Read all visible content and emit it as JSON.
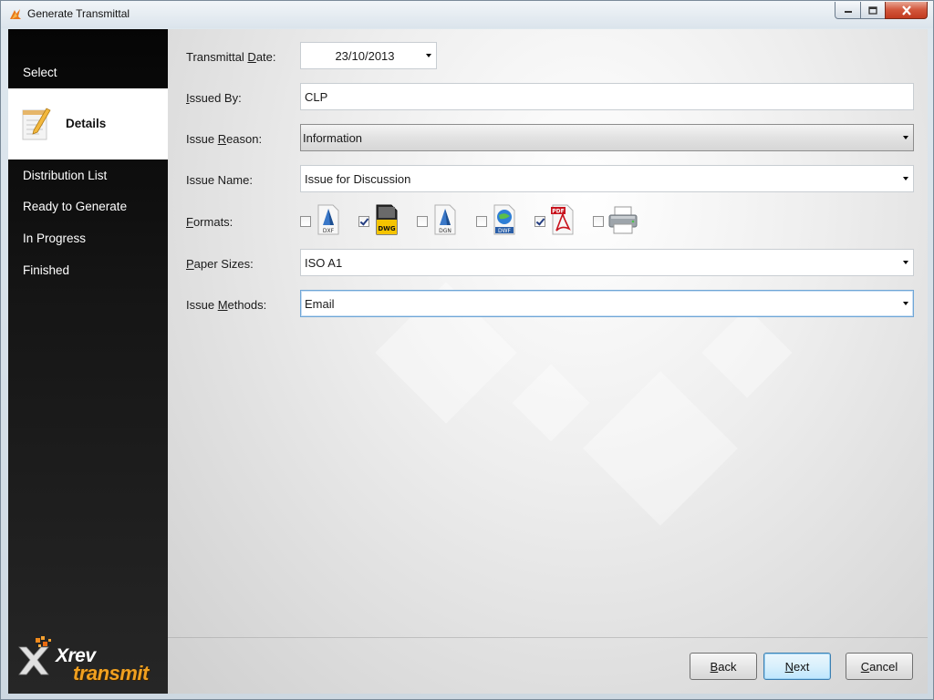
{
  "window": {
    "title": "Generate Transmittal"
  },
  "sidebar": {
    "items": [
      {
        "label": "Select"
      },
      {
        "label": "Details",
        "active": true
      },
      {
        "label": "Distribution List"
      },
      {
        "label": "Ready to Generate"
      },
      {
        "label": "In Progress"
      },
      {
        "label": "Finished"
      }
    ],
    "logo": {
      "line1": "Xrev",
      "line2": "transmit"
    }
  },
  "form": {
    "transmittal_date": {
      "label_pre": "Transmittal ",
      "label_key": "D",
      "label_post": "ate:",
      "value": "23/10/2013"
    },
    "issued_by": {
      "label_pre": "",
      "label_key": "I",
      "label_post": "ssued By:",
      "value": "CLP"
    },
    "issue_reason": {
      "label_pre": "Issue ",
      "label_key": "R",
      "label_post": "eason:",
      "value": "Information"
    },
    "issue_name": {
      "label_pre": "Issue Name:",
      "label_key": "",
      "label_post": "",
      "value": "Issue for Discussion"
    },
    "formats": {
      "label_pre": "",
      "label_key": "F",
      "label_post": "ormats:",
      "items": [
        {
          "icon": "dxf-file-icon",
          "text": "DXF",
          "checked": false
        },
        {
          "icon": "dwg-file-icon",
          "text": "DWG",
          "checked": true
        },
        {
          "icon": "dgn-file-icon",
          "text": "DGN",
          "checked": false
        },
        {
          "icon": "dwf-file-icon",
          "text": "DWF",
          "checked": false
        },
        {
          "icon": "pdf-file-icon",
          "text": "PDF",
          "checked": true
        },
        {
          "icon": "printer-icon",
          "text": "",
          "checked": false
        }
      ]
    },
    "paper_sizes": {
      "label_pre": "",
      "label_key": "P",
      "label_post": "aper Sizes:",
      "value": "ISO A1"
    },
    "issue_methods": {
      "label_pre": "Issue ",
      "label_key": "M",
      "label_post": "ethods:",
      "value": "Email"
    }
  },
  "buttons": {
    "back": {
      "key": "B",
      "rest": "ack"
    },
    "next": {
      "key": "N",
      "rest": "ext"
    },
    "cancel": {
      "key": "C",
      "rest": "ancel"
    }
  },
  "colors": {
    "sidebar_bg": "#111111",
    "accent_orange": "#f0a020",
    "default_button_border": "#3c7fb1"
  }
}
